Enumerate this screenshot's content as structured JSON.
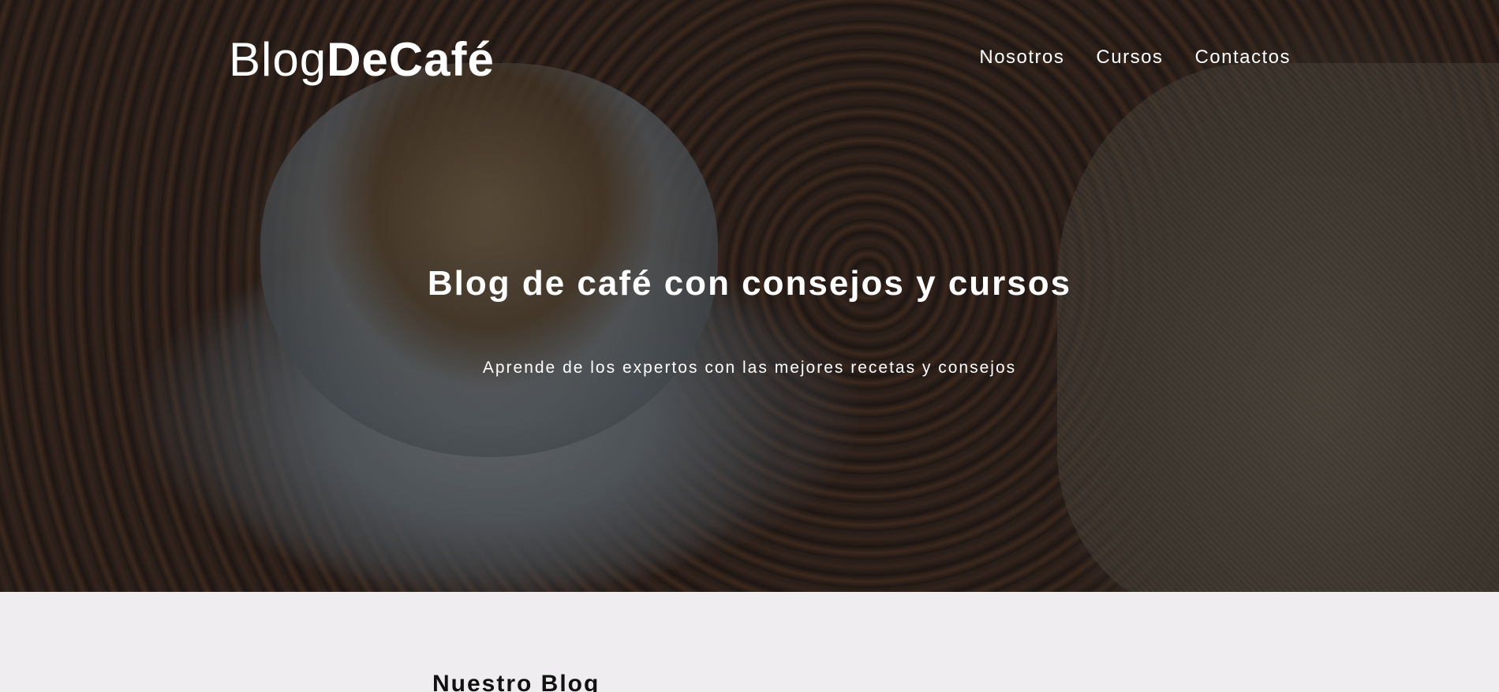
{
  "header": {
    "logo": {
      "light": "Blog",
      "bold": "DeCafé"
    },
    "nav": [
      {
        "label": "Nosotros"
      },
      {
        "label": "Cursos"
      },
      {
        "label": "Contactos"
      }
    ]
  },
  "hero": {
    "title": "Blog de café con consejos y cursos",
    "subtitle": "Aprende de los expertos con las mejores recetas y consejos"
  },
  "main": {
    "section_title": "Nuestro Blog"
  },
  "colors": {
    "text_light": "#ffffff",
    "page_bg": "#efedef",
    "heading_dark": "#111111"
  }
}
